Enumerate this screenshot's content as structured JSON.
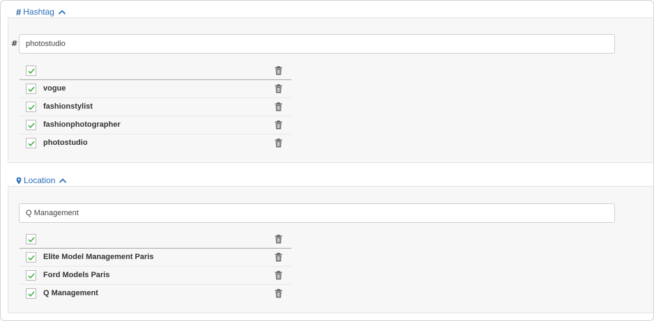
{
  "colors": {
    "accent": "#2a6ebb",
    "check": "#3cb043",
    "panel_bg": "#f7f7f7"
  },
  "hashtag": {
    "header_icon": "hash-icon",
    "header_title": "Hashtag",
    "input_prefix": "#",
    "input_value": "photostudio",
    "rows": [
      {
        "label": "vogue",
        "checked": true
      },
      {
        "label": "fashionstylist",
        "checked": true
      },
      {
        "label": "fashionphotographer",
        "checked": true
      },
      {
        "label": "photostudio",
        "checked": true
      }
    ]
  },
  "location": {
    "header_icon": "map-marker-icon",
    "header_title": "Location",
    "input_value": "Q Management",
    "rows": [
      {
        "label": "Elite Model Management Paris",
        "checked": true
      },
      {
        "label": "Ford Models Paris",
        "checked": true
      },
      {
        "label": "Q Management",
        "checked": true
      }
    ]
  }
}
